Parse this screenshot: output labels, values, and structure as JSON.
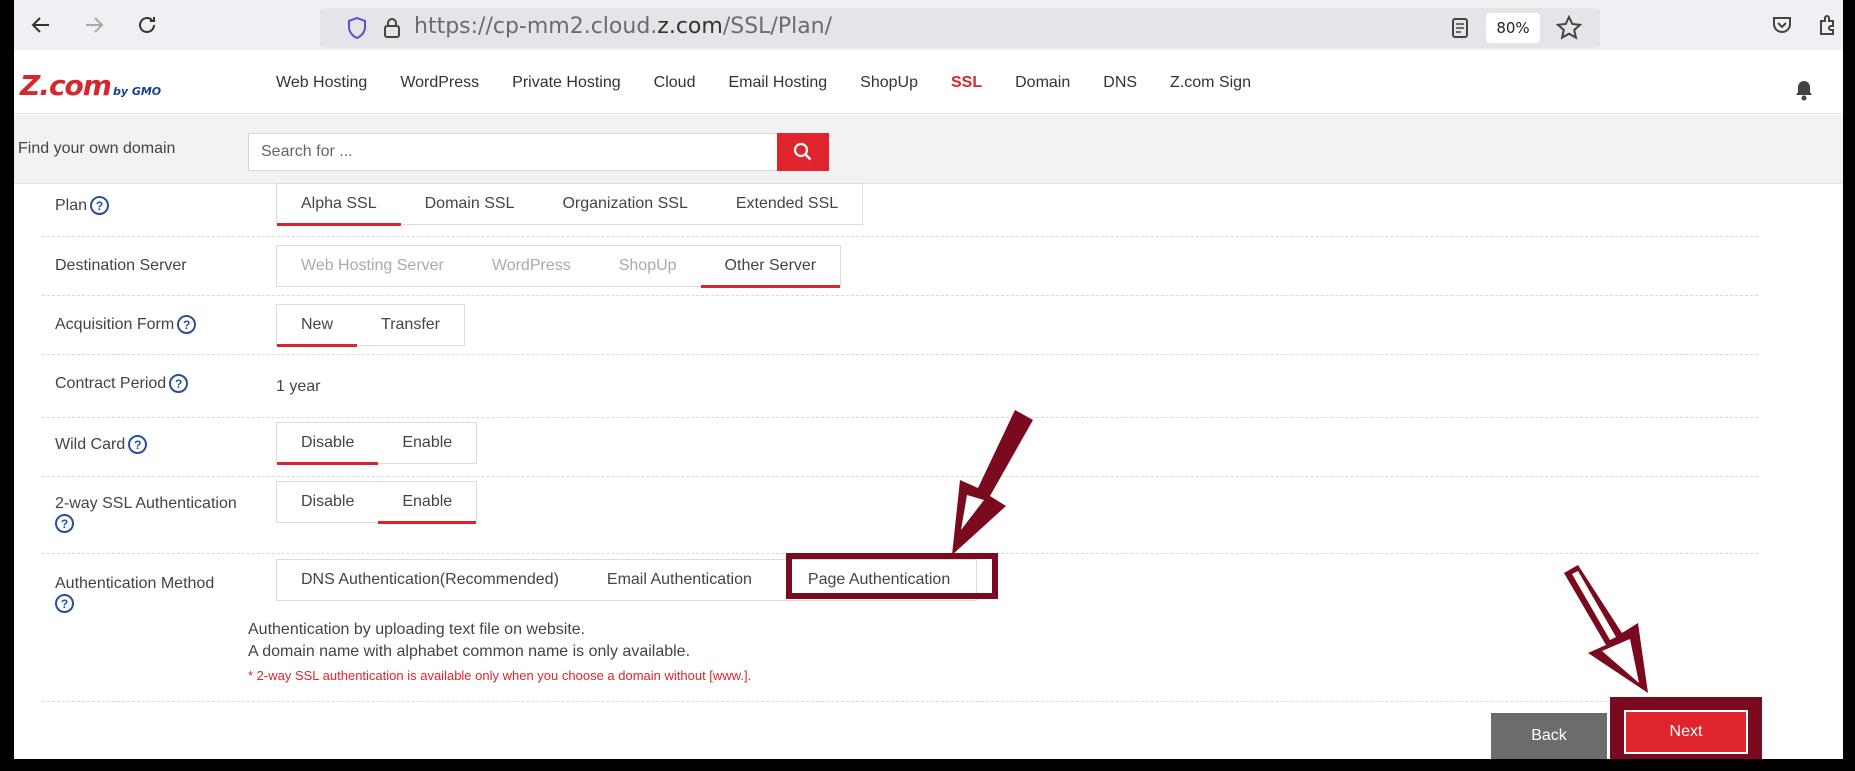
{
  "browser": {
    "url": "https://cp-mm2.cloud.z.com/SSL/Plan/",
    "zoom": "80%"
  },
  "header": {
    "logo_main": "Z.com",
    "logo_sub": "by GMO",
    "nav": [
      "Web Hosting",
      "WordPress",
      "Private Hosting",
      "Cloud",
      "Email Hosting",
      "ShopUp",
      "SSL",
      "Domain",
      "DNS",
      "Z.com Sign"
    ],
    "active_nav": "SSL"
  },
  "search": {
    "label": "Find your own domain",
    "placeholder": "Search for ..."
  },
  "form": {
    "plan": {
      "label": "Plan",
      "options": [
        "Alpha SSL",
        "Domain SSL",
        "Organization SSL",
        "Extended SSL"
      ],
      "selected": "Alpha SSL"
    },
    "destination": {
      "label": "Destination Server",
      "options": [
        "Web Hosting Server",
        "WordPress",
        "ShopUp",
        "Other Server"
      ],
      "selected": "Other Server"
    },
    "acquisition": {
      "label": "Acquisition Form",
      "options": [
        "New",
        "Transfer"
      ],
      "selected": "New"
    },
    "contract": {
      "label": "Contract Period",
      "value": "1 year"
    },
    "wildcard": {
      "label": "Wild Card",
      "options": [
        "Disable",
        "Enable"
      ],
      "selected": "Disable"
    },
    "twoway": {
      "label": "2-way SSL Authentication",
      "options": [
        "Disable",
        "Enable"
      ],
      "selected": "Enable"
    },
    "auth_method": {
      "label": "Authentication Method",
      "options": [
        "DNS Authentication(Recommended)",
        "Email Authentication",
        "Page Authentication"
      ],
      "selected": "Page Authentication",
      "desc_line1": "Authentication by uploading text file on website.",
      "desc_line2": "A domain name with alphabet common name is only available.",
      "note": "* 2-way SSL authentication is available only when you choose a domain without [www.]."
    }
  },
  "buttons": {
    "back": "Back",
    "next": "Next"
  },
  "colors": {
    "brand_red": "#d7262e",
    "annotation": "#7a0a1e",
    "help_blue": "#2a4f9a"
  }
}
